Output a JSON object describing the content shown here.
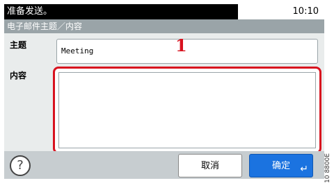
{
  "status": {
    "message": "准备发送。",
    "time": "10:10"
  },
  "title": "电子邮件主题／内容",
  "form": {
    "subject_label": "主题",
    "subject_value": "Meeting",
    "content_label": "内容",
    "content_value": ""
  },
  "callout": "1",
  "buttons": {
    "help": "?",
    "cancel": "取消",
    "ok": "确定",
    "enter": "↵"
  },
  "side_code": "10 8800E"
}
